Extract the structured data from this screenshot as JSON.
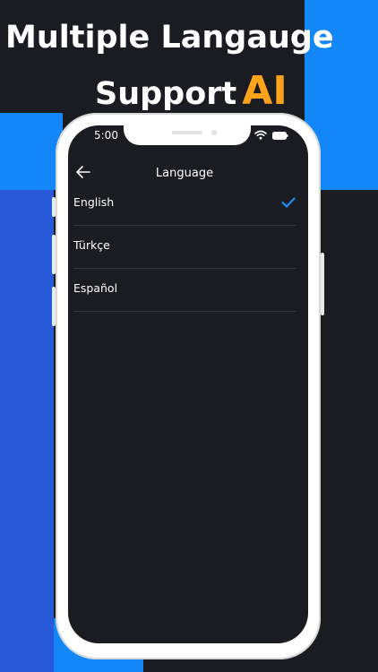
{
  "headline": {
    "line1": "Multiple Langauge",
    "line2": "Support",
    "accent": "AI"
  },
  "status_bar": {
    "time": "5:00",
    "icons": [
      "wifi-icon",
      "battery-icon"
    ]
  },
  "header": {
    "back_icon": "arrow-left-icon",
    "title": "Language"
  },
  "languages": [
    {
      "label": "English",
      "selected": true
    },
    {
      "label": "Türkçe",
      "selected": false
    },
    {
      "label": "Español",
      "selected": false
    }
  ],
  "colors": {
    "background_dark": "#1b1c21",
    "accent_blue": "#1487f8",
    "secondary_blue": "#2859d8",
    "ai_orange": "#ffa31a",
    "check_blue": "#1a8cf6"
  }
}
